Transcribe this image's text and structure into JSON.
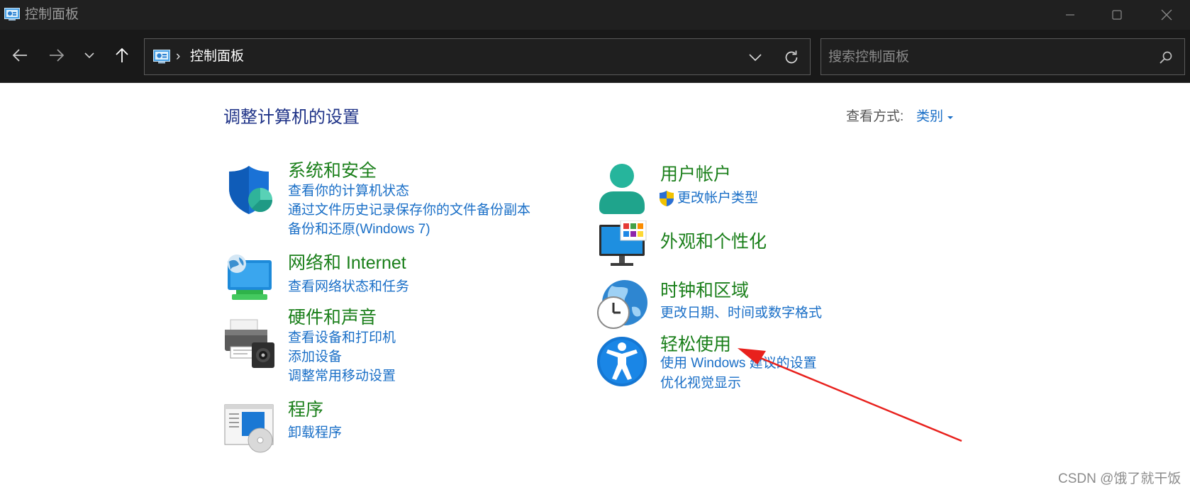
{
  "window": {
    "title": "控制面板",
    "minimize": "minimize",
    "maximize": "maximize",
    "close": "close"
  },
  "nav": {
    "back": "back",
    "forward": "forward",
    "recent": "recent-locations",
    "up": "up"
  },
  "address": {
    "separator": "›",
    "crumb": "控制面板"
  },
  "search": {
    "placeholder": "搜索控制面板"
  },
  "content": {
    "title": "调整计算机的设置",
    "view_label": "查看方式:",
    "view_value": "类别"
  },
  "categories": [
    {
      "title": "系统和安全",
      "icon": "shield-icon",
      "links": [
        "查看你的计算机状态",
        "通过文件历史记录保存你的文件备份副本",
        "备份和还原(Windows 7)"
      ]
    },
    {
      "title": "网络和 Internet",
      "icon": "network-icon",
      "links": [
        "查看网络状态和任务"
      ]
    },
    {
      "title": "硬件和声音",
      "icon": "printer-icon",
      "links": [
        "查看设备和打印机",
        "添加设备",
        "调整常用移动设置"
      ]
    },
    {
      "title": "程序",
      "icon": "programs-icon",
      "links": [
        "卸载程序"
      ]
    },
    {
      "title": "用户帐户",
      "icon": "user-icon",
      "links": [
        "更改帐户类型"
      ]
    },
    {
      "title": "外观和个性化",
      "icon": "appearance-icon",
      "links": []
    },
    {
      "title": "时钟和区域",
      "icon": "clock-globe-icon",
      "links": [
        "更改日期、时间或数字格式"
      ]
    },
    {
      "title": "轻松使用",
      "icon": "accessibility-icon",
      "links": [
        "使用 Windows 建议的设置",
        "优化视觉显示"
      ]
    }
  ],
  "watermark": "CSDN @饿了就干饭",
  "colors": {
    "titlebar": "#202020",
    "navbar": "#191919",
    "heading": "#1e3287",
    "category": "#1a7f1a",
    "link": "#1a6fc7",
    "annotation_arrow": "#e8211d"
  }
}
